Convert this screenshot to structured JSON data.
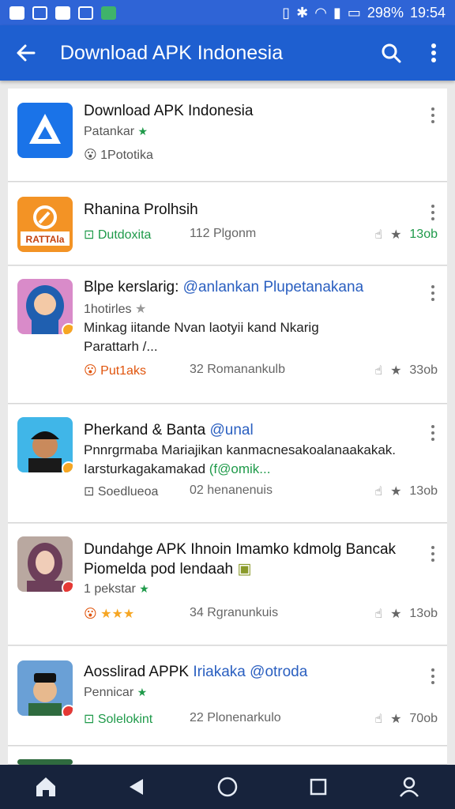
{
  "status_bar": {
    "battery": "298%",
    "time": "19:54"
  },
  "app_bar": {
    "title": "Download APK Indonesia"
  },
  "items": [
    {
      "name": "Download APK Indonesia",
      "name_hl": "",
      "sub": "Patankar",
      "meta_left": "1Pototika",
      "meta_right": "",
      "rating": "",
      "desc1": "",
      "desc2": "",
      "icon": "apk-logo-icon",
      "icon_color": "#1a73e8"
    },
    {
      "name": "Rhanina Prolhsih",
      "name_hl": "",
      "sub": "Dutdoxita",
      "meta_left": "",
      "meta_right": "112 Plgonm",
      "rating": "13ob",
      "desc1": "",
      "desc2": "",
      "icon": "orange-app-icon",
      "icon_color": "#f39325",
      "icon_text": "RATTAla"
    },
    {
      "name": "Blpe kerslarig: ",
      "name_hl": "@anlankan Plupetanakana",
      "sub": "1hotirles",
      "meta_left": "Put1aks",
      "meta_right": "32 Romanankulb",
      "rating": "33ob",
      "desc1": "Minkag iitande Nvan laotyii kand Nkarig",
      "desc2": "Parattarh /...",
      "icon": "avatar-hijab-icon",
      "icon_color": "#d98bc9"
    },
    {
      "name": "Pherkand & Banta ",
      "name_hl": "@unal",
      "sub": "Soedlueoa",
      "meta_left": "",
      "meta_right": "02 henanenuis",
      "rating": "13ob",
      "desc1": "Pnnrgrmaba Mariajikan kanmacnesakoalanaakakak.",
      "desc2": "Iarsturkagakamakad ",
      "desc2_hl": "(f@omik...",
      "icon": "avatar-cap-icon",
      "icon_color": "#40b6e8"
    },
    {
      "name": "Dundahge APK Ihnoin Imamko kdmolg Bancak",
      "name_hl": "",
      "name2": "Piomelda pod lendaah",
      "sub": "1 pekstar",
      "meta_left": "",
      "meta_right": "34 Rgranunkuis",
      "rating": "13ob",
      "desc1": "",
      "desc2": "",
      "icon": "photo-woman-icon",
      "icon_color": "#b9a8a0"
    },
    {
      "name": "Aosslirad APPK ",
      "name_hl": "Iriakaka @otroda",
      "sub": "Pennicar",
      "meta_left": "Solelokint",
      "meta_right": "22 Plonenarkulo",
      "rating": "70ob",
      "desc1": "",
      "desc2": "",
      "icon": "avatar-peci-icon",
      "icon_color": "#6aa0d6"
    }
  ],
  "colors": {
    "primary": "#1e5fd0",
    "status": "#2f64d6",
    "green": "#1f9a4a",
    "navbar": "#17233c"
  }
}
